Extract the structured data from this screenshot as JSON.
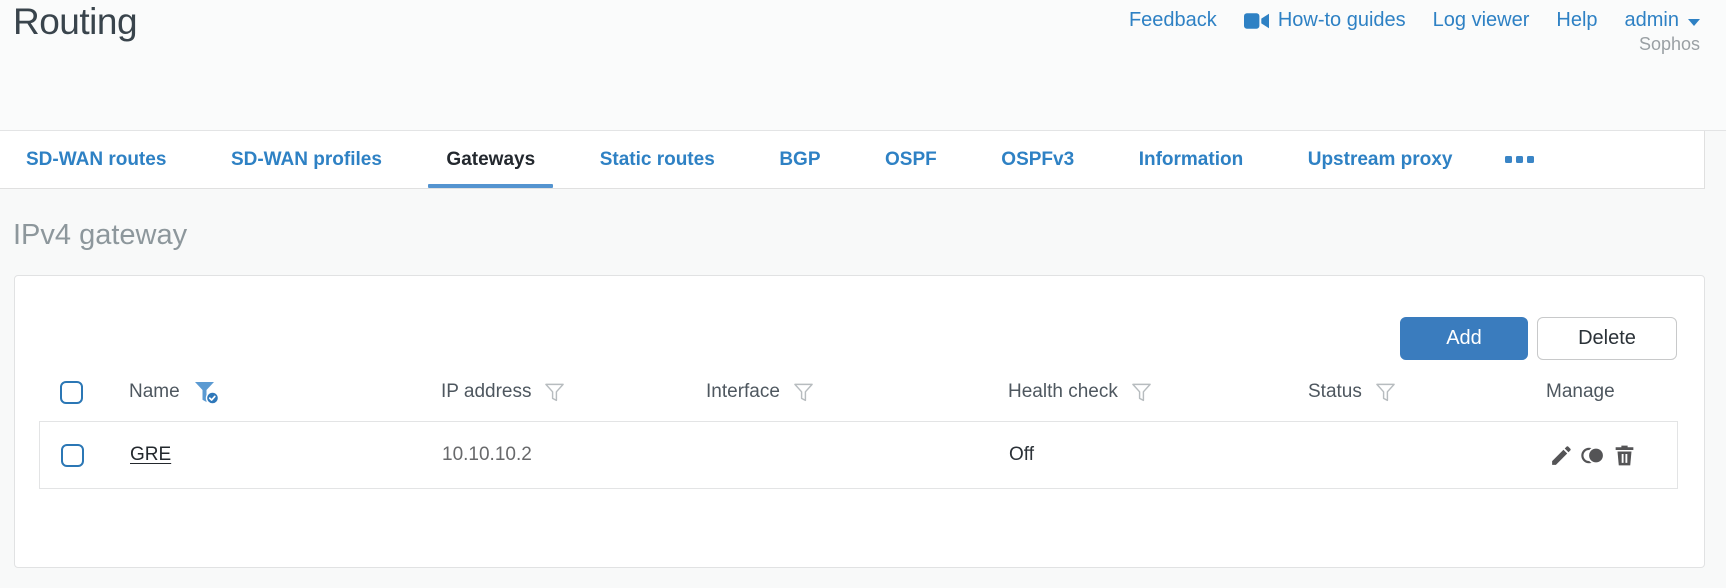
{
  "header": {
    "title": "Routing",
    "nav": {
      "feedback": "Feedback",
      "howto_guides": "How-to guides",
      "log_viewer": "Log viewer",
      "help": "Help",
      "user": "admin",
      "brand": "Sophos"
    }
  },
  "tabs": [
    {
      "label": "SD-WAN routes",
      "active": false
    },
    {
      "label": "SD-WAN profiles",
      "active": false
    },
    {
      "label": "Gateways",
      "active": true
    },
    {
      "label": "Static routes",
      "active": false
    },
    {
      "label": "BGP",
      "active": false
    },
    {
      "label": "OSPF",
      "active": false
    },
    {
      "label": "OSPFv3",
      "active": false
    },
    {
      "label": "Information",
      "active": false
    },
    {
      "label": "Upstream proxy",
      "active": false
    }
  ],
  "section": {
    "title": "IPv4 gateway"
  },
  "toolbar": {
    "add": "Add",
    "delete": "Delete"
  },
  "table": {
    "headers": {
      "name": "Name",
      "ip": "IP address",
      "interface": "Interface",
      "health": "Health check",
      "status": "Status",
      "manage": "Manage"
    },
    "filters": {
      "name": "active",
      "ip": "inactive",
      "interface": "inactive",
      "health": "inactive",
      "status": "inactive"
    },
    "rows": [
      {
        "name": "GRE",
        "ip": "10.10.10.2",
        "interface": "",
        "health": "Off",
        "status_color": "#84c440"
      }
    ]
  },
  "colors": {
    "accent_blue": "#2e81c4",
    "button_blue": "#3a7cbe",
    "active_tab_underline": "#5494d0",
    "status_green": "#84c440",
    "icon_gray": "#545456"
  }
}
